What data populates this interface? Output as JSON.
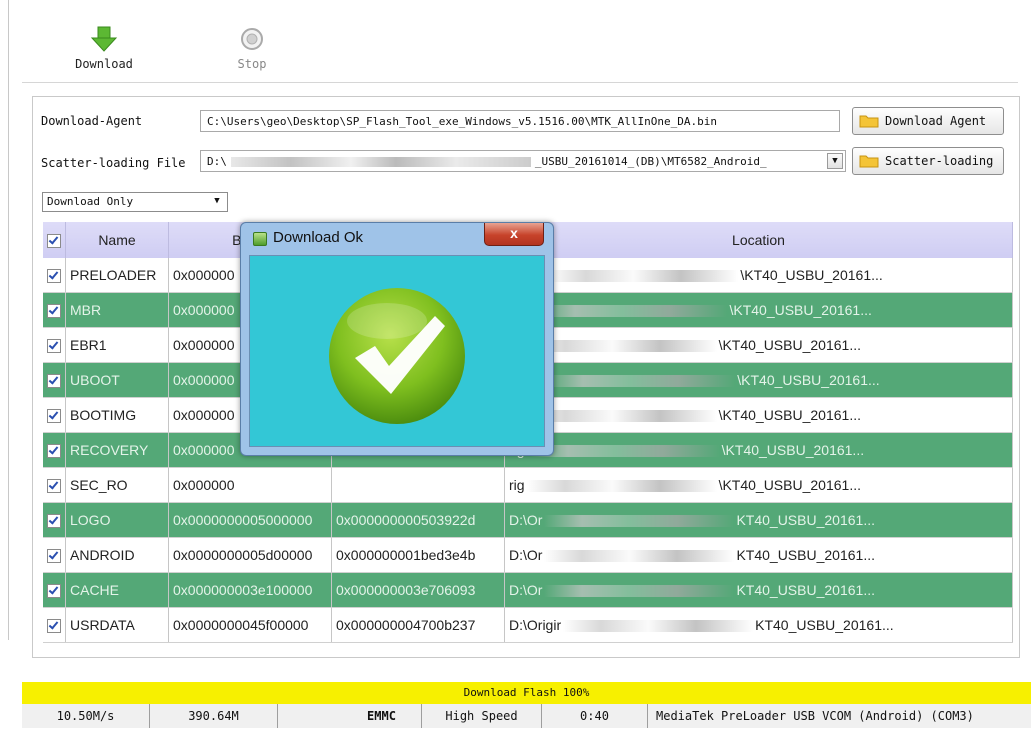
{
  "toolbar": {
    "download_label": "Download",
    "stop_label": "Stop",
    "download_icon": "green-down-arrow-icon",
    "stop_icon": "stop-circle-icon"
  },
  "agent": {
    "label": "Download-Agent",
    "path": "C:\\Users\\geo\\Desktop\\SP_Flash_Tool_exe_Windows_v5.1516.00\\MTK_AllInOne_DA.bin",
    "button": "Download Agent"
  },
  "scatter": {
    "label": "Scatter-loading File",
    "path_start": "D:\\",
    "path_end": "_USBU_20161014_(DB)\\MT6582_Android_",
    "button": "Scatter-loading"
  },
  "mode": {
    "selected": "Download Only"
  },
  "table": {
    "headers": [
      "Name",
      "Begin",
      "",
      "Location"
    ],
    "rows": [
      {
        "name": "PRELOADER",
        "begin": "0x000000",
        "end": "",
        "loc_start": "riginal",
        "loc_end": "\\KT40_USBU_20161..."
      },
      {
        "name": "MBR",
        "begin": "0x000000",
        "end": "",
        "loc_start": "rigin",
        "loc_end": "\\KT40_USBU_20161..."
      },
      {
        "name": "EBR1",
        "begin": "0x000000",
        "end": "",
        "loc_start": "rig",
        "loc_end": "\\KT40_USBU_20161..."
      },
      {
        "name": "UBOOT",
        "begin": "0x000000",
        "end": "",
        "loc_start": "rigina",
        "loc_end": "\\KT40_USBU_20161..."
      },
      {
        "name": "BOOTIMG",
        "begin": "0x000000",
        "end": "",
        "loc_start": "rig",
        "loc_end": "\\KT40_USBU_20161..."
      },
      {
        "name": "RECOVERY",
        "begin": "0x000000",
        "end": "",
        "loc_start": "rigi",
        "loc_end": "\\KT40_USBU_20161..."
      },
      {
        "name": "SEC_RO",
        "begin": "0x000000",
        "end": "",
        "loc_start": "rig",
        "loc_end": "\\KT40_USBU_20161..."
      },
      {
        "name": "LOGO",
        "begin": "0x0000000005000000",
        "end": "0x000000000503922d",
        "loc_start": "D:\\Or",
        "loc_end": "KT40_USBU_20161..."
      },
      {
        "name": "ANDROID",
        "begin": "0x0000000005d00000",
        "end": "0x000000001bed3e4b",
        "loc_start": "D:\\Or",
        "loc_end": "KT40_USBU_20161..."
      },
      {
        "name": "CACHE",
        "begin": "0x000000003e100000",
        "end": "0x000000003e706093",
        "loc_start": "D:\\Or",
        "loc_end": "KT40_USBU_20161..."
      },
      {
        "name": "USRDATA",
        "begin": "0x0000000045f00000",
        "end": "0x000000004700b237",
        "loc_start": "D:\\Origir",
        "loc_end": "KT40_USBU_20161..."
      }
    ]
  },
  "dialog": {
    "title": "Download Ok",
    "close": "x",
    "icon": "green-checkmark-icon"
  },
  "progress": {
    "text": "Download Flash 100%",
    "percent": 100
  },
  "status": {
    "speed": "10.50M/s",
    "size": "390.64M",
    "storage": "EMMC",
    "mode": "High Speed",
    "time": "0:40",
    "port": "MediaTek PreLoader USB VCOM (Android) (COM3)"
  },
  "colors": {
    "row_highlight": "#54a877",
    "progress": "#f7f000",
    "dialog_client": "#33c7d6",
    "header": "#d6d4f5"
  }
}
